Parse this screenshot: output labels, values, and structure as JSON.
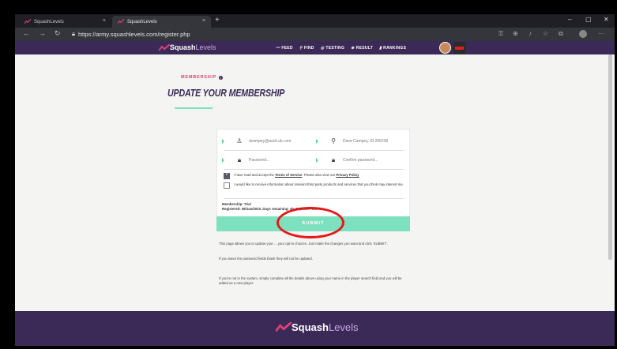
{
  "browser": {
    "tabs": [
      {
        "label": "SquashLevels",
        "close": "×"
      },
      {
        "label": "SquashLevels",
        "close": "×"
      }
    ],
    "new_tab": "+",
    "url": "https://army.squashlevels.com/register.php",
    "window_controls": {
      "minimize": "–",
      "maximize": "▢",
      "close": "✕"
    }
  },
  "site": {
    "logo_main": "Squash",
    "logo_accent": "Levels",
    "nav": [
      {
        "icon": "feed-icon",
        "label": "FEED"
      },
      {
        "icon": "search-icon",
        "label": "FIND"
      },
      {
        "icon": "testing-icon",
        "label": "TESTING"
      },
      {
        "icon": "result-icon",
        "label": "RESULT"
      },
      {
        "icon": "rankings-icon",
        "label": "RANKINGS"
      }
    ]
  },
  "page": {
    "section_label": "MEMBERSHIP",
    "title": "UPDATE YOUR MEMBERSHIP"
  },
  "form": {
    "email_value": "dcampey@ascb.uk.com",
    "name_value": "Dave Campey, ID:206239",
    "password_placeholder": "Password...",
    "confirm_placeholder": "Confirm password...",
    "terms_prefix": "I have read and accept the ",
    "terms_link": "Terms of Service",
    "terms_mid": ". Please also view our ",
    "privacy_link": "Privacy Policy",
    "terms_checked": true,
    "thirdparty_text": "I would like to receive information about relevant third party products and services that you think may interest me.",
    "thirdparty_checked": false,
    "membership_line": "Membership: Trial",
    "registered_line": "Registered: 08/Jan/2020. Days remaining: 30. Expires: Fe...",
    "submit_label": "SUBMIT"
  },
  "help": {
    "p1": "This page allows you to update your ... your opt-in choices. Just make the changes you want and click 'SUBMIT'.",
    "p2": "If you leave the password fields blank they will not be updated.",
    "p3": "If you're not in the system, simply complete all the details above using your name in the player search field and you will be added as a new player."
  },
  "footer": {
    "logo_main": "Squash",
    "logo_accent": "Levels"
  },
  "colors": {
    "brand_purple": "#3b2a57",
    "accent_mint": "#7de0be",
    "accent_pink": "#d9417a",
    "annotation_red": "#e31919"
  }
}
